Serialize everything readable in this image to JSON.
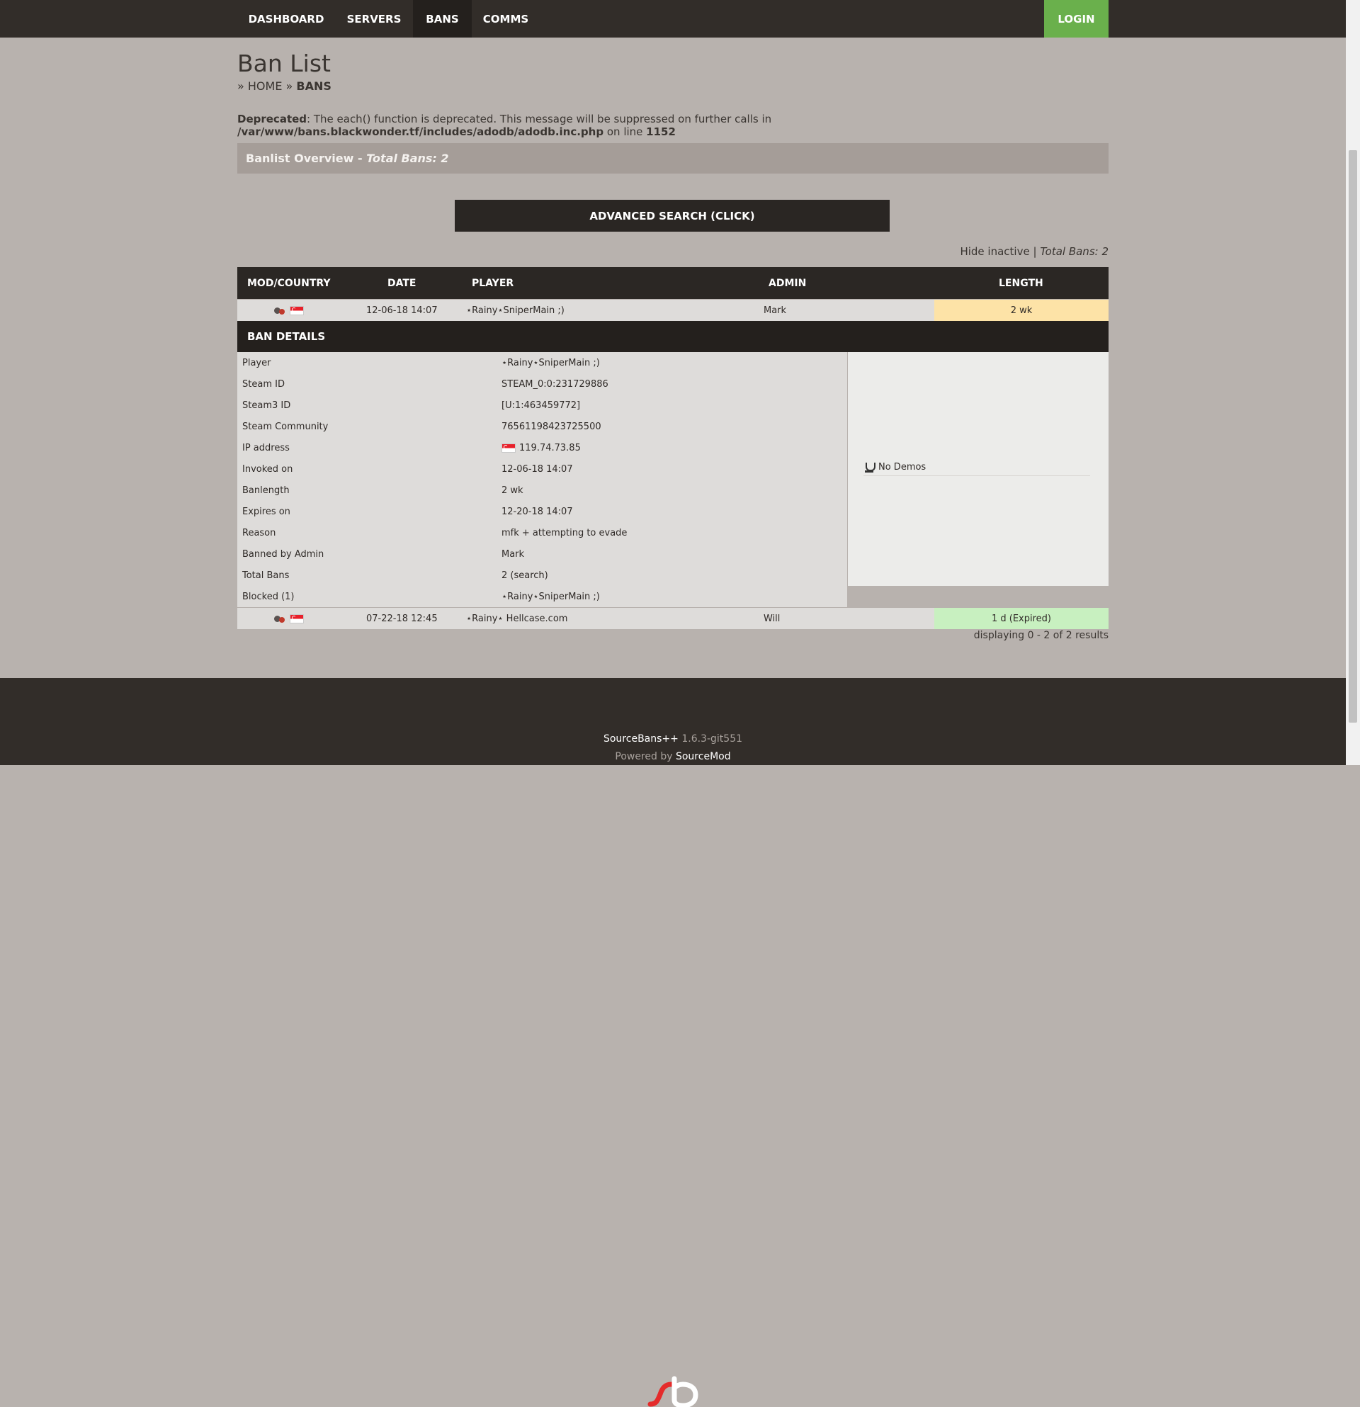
{
  "nav": {
    "items": [
      "DASHBOARD",
      "SERVERS",
      "BANS",
      "COMMS"
    ],
    "active": "BANS",
    "login": "LOGIN"
  },
  "page": {
    "title": "Ban List",
    "breadcrumb_prefix": "»",
    "breadcrumb_home": "HOME",
    "breadcrumb_sep": "»",
    "breadcrumb_current": "BANS"
  },
  "warning": {
    "label": "Deprecated",
    "text": ": The each() function is deprecated. This message will be suppressed on further calls in ",
    "path": "/var/www/bans.blackwonder.tf/includes/adodb/adodb.inc.php",
    "on": " on line ",
    "line": "1152"
  },
  "overview": {
    "label": "Banlist Overview - ",
    "total": "Total Bans: 2"
  },
  "advanced_search": "ADVANCED SEARCH (CLICK)",
  "hide_inactive": "Hide inactive",
  "hide_sep": "|",
  "total_bans": "Total Bans: 2",
  "table": {
    "headers": [
      "MOD/COUNTRY",
      "DATE",
      "PLAYER",
      "ADMIN",
      "LENGTH"
    ],
    "rows": [
      {
        "date": "12-06-18 14:07",
        "player": "⋆Rainy⋆SniperMain ;)",
        "admin": "Mark",
        "length": "2 wk",
        "length_color": "#fde3a7"
      },
      {
        "date": "07-22-18 12:45",
        "player": "⋆Rainy⋆ Hellcase.com",
        "admin": "Will",
        "length": "1 d (Expired)",
        "length_color": "#c8f0c0"
      }
    ]
  },
  "details": {
    "title": "BAN DETAILS",
    "fields": [
      {
        "k": "Player",
        "v": "⋆Rainy⋆SniperMain ;)"
      },
      {
        "k": "Steam ID",
        "v": "STEAM_0:0:231729886"
      },
      {
        "k": "Steam3 ID",
        "v": "[U:1:463459772]"
      },
      {
        "k": "Steam Community",
        "v": "76561198423725500"
      },
      {
        "k": "IP address",
        "v": "119.74.73.85"
      },
      {
        "k": "Invoked on",
        "v": "12-06-18 14:07"
      },
      {
        "k": "Banlength",
        "v": "2 wk"
      },
      {
        "k": "Expires on",
        "v": "12-20-18 14:07"
      },
      {
        "k": "Reason",
        "v": "mfk + attempting to evade"
      },
      {
        "k": "Banned by Admin",
        "v": "Mark"
      },
      {
        "k": "Total Bans",
        "v": "2 (search)"
      },
      {
        "k": "Blocked (1)",
        "v": "⋆Rainy⋆SniperMain ;)"
      }
    ],
    "demos": "No Demos"
  },
  "results": "displaying 0 - 2 of 2 results",
  "footer": {
    "product": "SourceBans++",
    "version": "1.6.3-git551",
    "powered_by": "Powered by",
    "powered_link": "SourceMod"
  }
}
